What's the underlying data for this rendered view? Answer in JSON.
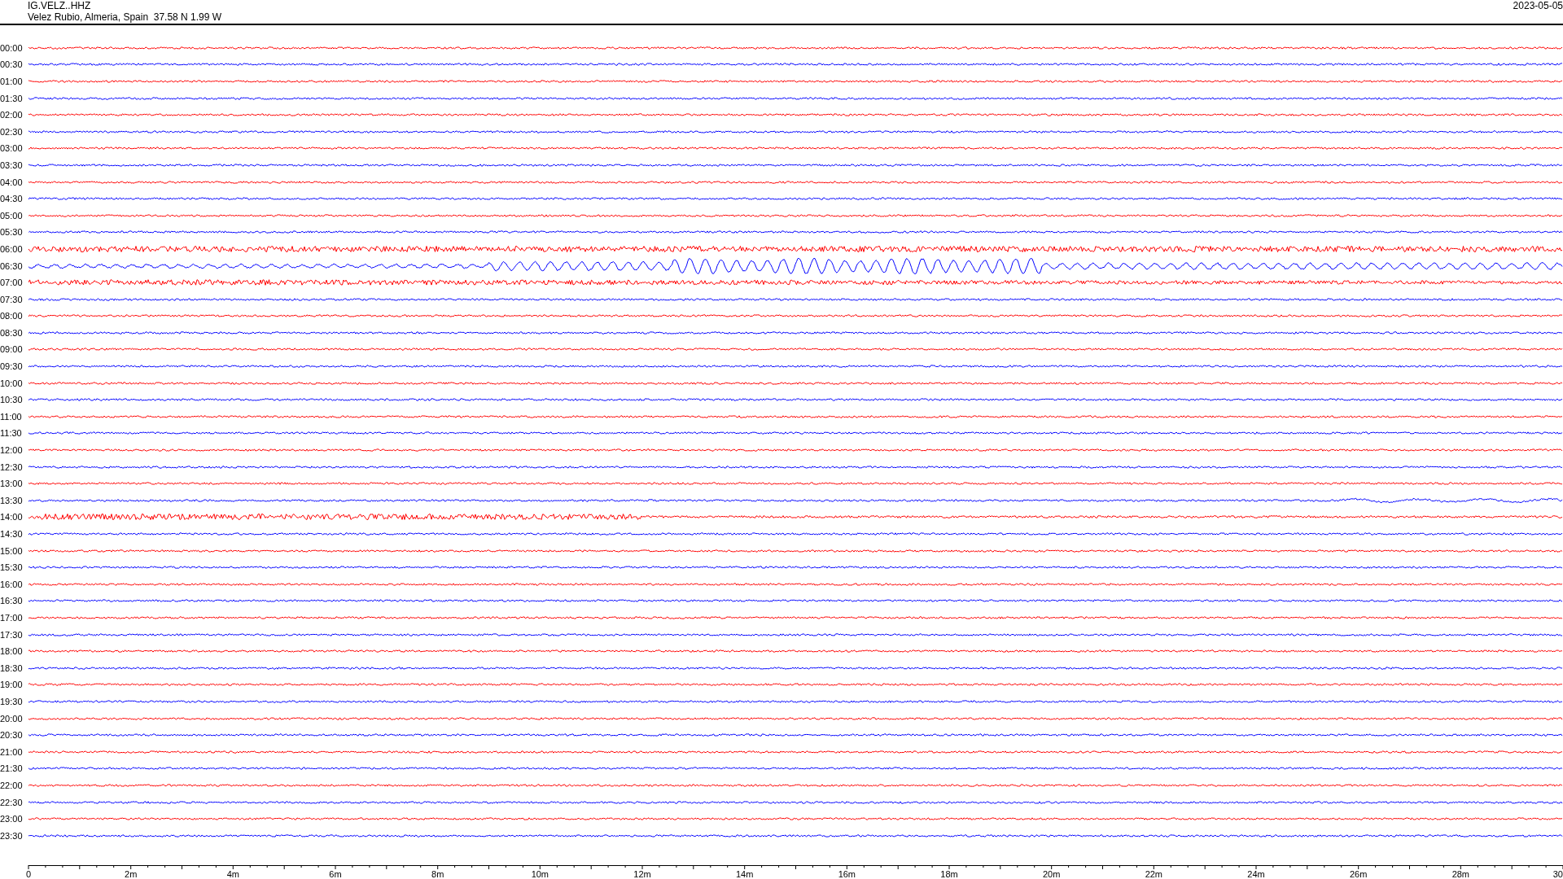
{
  "header": {
    "station": "IG.VELZ..HHZ",
    "location": "Velez Rubio, Almeria, Spain  37.58 N 1.99 W",
    "date": "2023-05-05"
  },
  "traces": [
    {
      "time": "00:00",
      "color": "#ff0000"
    },
    {
      "time": "00:30",
      "color": "#0000ff"
    },
    {
      "time": "01:00",
      "color": "#ff0000"
    },
    {
      "time": "01:30",
      "color": "#0000ff"
    },
    {
      "time": "02:00",
      "color": "#ff0000"
    },
    {
      "time": "02:30",
      "color": "#0000ff"
    },
    {
      "time": "03:00",
      "color": "#ff0000"
    },
    {
      "time": "03:30",
      "color": "#0000ff"
    },
    {
      "time": "04:00",
      "color": "#ff0000"
    },
    {
      "time": "04:30",
      "color": "#0000ff"
    },
    {
      "time": "05:00",
      "color": "#ff0000"
    },
    {
      "time": "05:30",
      "color": "#0000ff"
    },
    {
      "time": "06:00",
      "color": "#ff0000"
    },
    {
      "time": "06:30",
      "color": "#0000ff"
    },
    {
      "time": "07:00",
      "color": "#ff0000"
    },
    {
      "time": "07:30",
      "color": "#0000ff"
    },
    {
      "time": "08:00",
      "color": "#ff0000"
    },
    {
      "time": "08:30",
      "color": "#0000ff"
    },
    {
      "time": "09:00",
      "color": "#ff0000"
    },
    {
      "time": "09:30",
      "color": "#0000ff"
    },
    {
      "time": "10:00",
      "color": "#ff0000"
    },
    {
      "time": "10:30",
      "color": "#0000ff"
    },
    {
      "time": "11:00",
      "color": "#ff0000"
    },
    {
      "time": "11:30",
      "color": "#0000ff"
    },
    {
      "time": "12:00",
      "color": "#ff0000"
    },
    {
      "time": "12:30",
      "color": "#0000ff"
    },
    {
      "time": "13:00",
      "color": "#ff0000"
    },
    {
      "time": "13:30",
      "color": "#0000ff"
    },
    {
      "time": "14:00",
      "color": "#ff0000"
    },
    {
      "time": "14:30",
      "color": "#0000ff"
    },
    {
      "time": "15:00",
      "color": "#ff0000"
    },
    {
      "time": "15:30",
      "color": "#0000ff"
    },
    {
      "time": "16:00",
      "color": "#ff0000"
    },
    {
      "time": "16:30",
      "color": "#0000ff"
    },
    {
      "time": "17:00",
      "color": "#ff0000"
    },
    {
      "time": "17:30",
      "color": "#0000ff"
    },
    {
      "time": "18:00",
      "color": "#ff0000"
    },
    {
      "time": "18:30",
      "color": "#0000ff"
    },
    {
      "time": "19:00",
      "color": "#ff0000"
    },
    {
      "time": "19:30",
      "color": "#0000ff"
    },
    {
      "time": "20:00",
      "color": "#ff0000"
    },
    {
      "time": "20:30",
      "color": "#0000ff"
    },
    {
      "time": "21:00",
      "color": "#ff0000"
    },
    {
      "time": "21:30",
      "color": "#0000ff"
    },
    {
      "time": "22:00",
      "color": "#ff0000"
    },
    {
      "time": "22:30",
      "color": "#0000ff"
    },
    {
      "time": "23:00",
      "color": "#ff0000"
    },
    {
      "time": "23:30",
      "color": "#0000ff"
    }
  ],
  "x_axis": {
    "labels": [
      "0",
      "2m",
      "4m",
      "6m",
      "8m",
      "10m",
      "12m",
      "14m",
      "16m",
      "18m",
      "20m",
      "22m",
      "24m",
      "26m",
      "28m",
      "30"
    ]
  }
}
